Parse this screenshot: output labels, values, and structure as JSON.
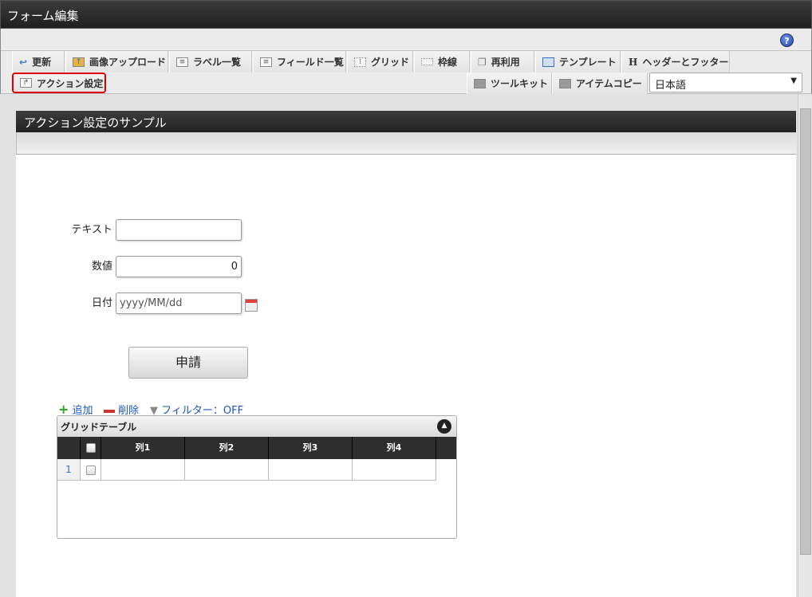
{
  "title": "フォーム編集",
  "help": "?",
  "tabs": [
    "更新",
    "画像アップロード",
    "ラベル一覧",
    "フィールド一覧",
    "グリッド",
    "枠線",
    "再利用",
    "テンプレート",
    "ヘッダーとフッター"
  ],
  "tab_icons": [
    "↩",
    "▲",
    "≡",
    "≡",
    "⋮",
    "⋯",
    "❐",
    "□",
    "H"
  ],
  "row2": {
    "action": "アクション設定",
    "toolkit": "ツールキット",
    "itemcopy": "アイテムコピー"
  },
  "language": {
    "selected": "日本語",
    "arrow": "▼"
  },
  "panel": {
    "title": "アクション設定のサンプル"
  },
  "form": {
    "text_label": "テキスト",
    "text_value": "",
    "number_label": "数値",
    "number_value": "0",
    "date_label": "日付",
    "date_placeholder": "yyyy/MM/dd",
    "submit": "申請"
  },
  "grid_actions": {
    "add": "追加",
    "delete": "削除",
    "filter": "フィルター：OFF"
  },
  "grid": {
    "title": "グリッドテーブル",
    "columns": [
      "列1",
      "列2",
      "列3",
      "列4"
    ],
    "rows": [
      {
        "num": "1"
      }
    ]
  }
}
